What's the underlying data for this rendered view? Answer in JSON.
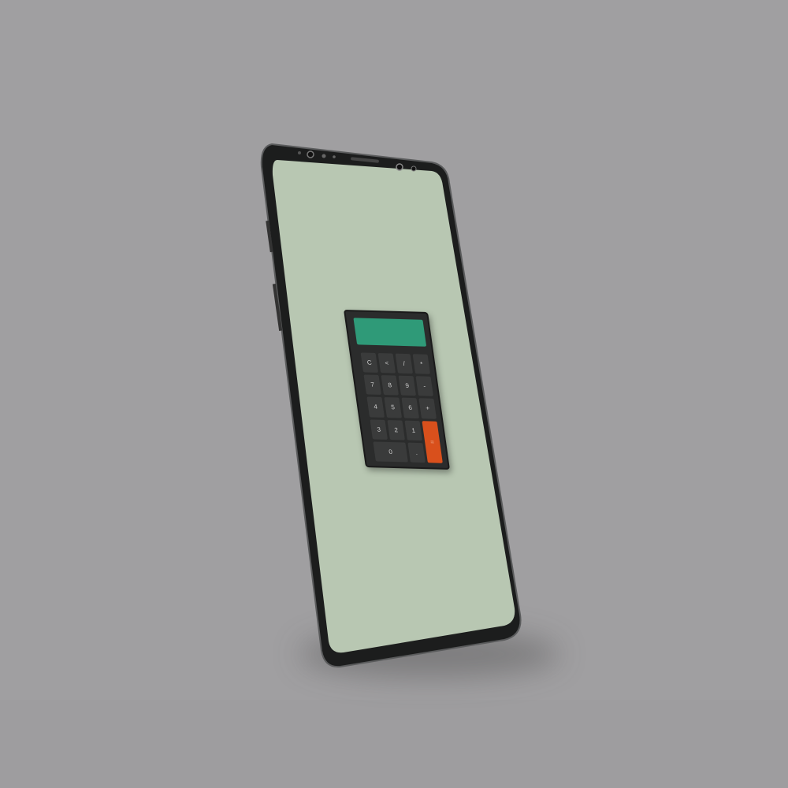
{
  "calculator": {
    "display": "",
    "keys": [
      "C",
      "<",
      "/",
      "*",
      "7",
      "8",
      "9",
      "-",
      "4",
      "5",
      "6",
      "+",
      "3",
      "2",
      "1",
      "=",
      "0",
      "."
    ],
    "colors": {
      "display": "#2f9a78",
      "equals": "#d9501c",
      "body": "#2b2c2c",
      "screen": "#b8c7b2"
    }
  }
}
